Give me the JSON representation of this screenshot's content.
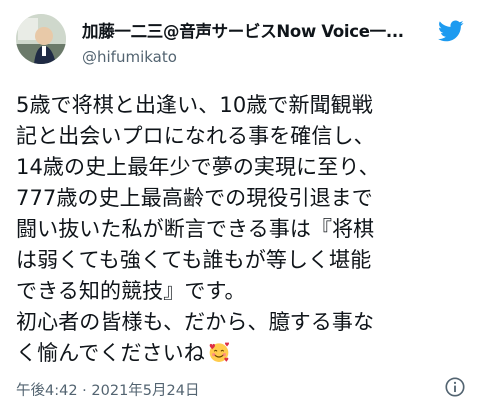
{
  "tweet": {
    "author": {
      "display_name": "加藤一二三@音声サービスNow Voice一...",
      "handle": "@hifumikato",
      "avatar": "avatar-photo"
    },
    "brand_icon": "twitter-bird-icon",
    "brand_color": "#1d9bf0",
    "body_lines": [
      "5歳で将棋と出逢い、10歳で新聞観戦",
      "記と出会いプロになれる事を確信し、",
      "14歳の史上最年少で夢の実現に至り、",
      "777歳の史上最高齢での現役引退まで",
      "闘い抜いた私が断言できる事は『将棋",
      "は弱くても強くても誰もが等しく堪能",
      "できる知的競技』です。",
      "初心者の皆様も、だから、臆する事な",
      "く愉んでくださいね"
    ],
    "emoji": "smiling-face-with-hearts-emoji",
    "timestamp": "午後4:42 · 2021年5月24日",
    "info_icon": "info-icon"
  }
}
